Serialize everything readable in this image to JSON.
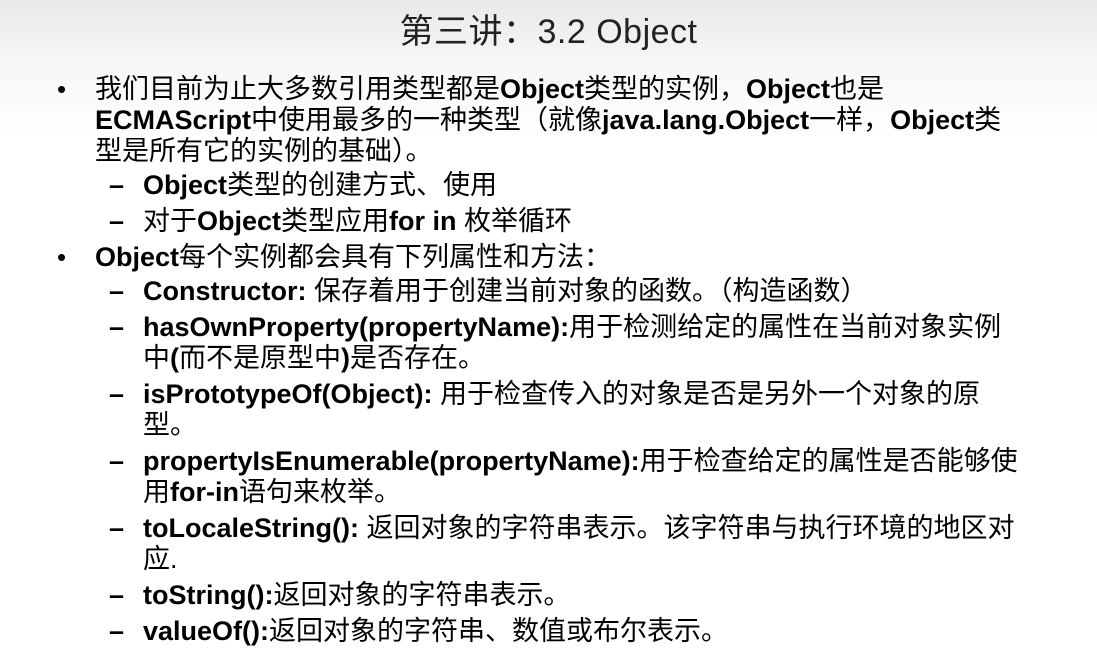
{
  "slide": {
    "title": "第三讲：3.2  Object",
    "bullet_char": "•",
    "dash_char": "–"
  },
  "items": [
    {
      "level": 1,
      "parts": [
        {
          "b": false,
          "text": "我们目前为止大多数引用类型都是"
        },
        {
          "b": true,
          "text": "Object"
        },
        {
          "b": false,
          "text": "类型的实例，"
        },
        {
          "b": true,
          "text": "Object"
        },
        {
          "b": false,
          "text": "也是"
        },
        {
          "b": true,
          "text": "ECMAScript"
        },
        {
          "b": false,
          "text": "中使用最多的一种类型（就像"
        },
        {
          "b": true,
          "text": "java.lang.Object"
        },
        {
          "b": false,
          "text": "一样，"
        },
        {
          "b": true,
          "text": "Object"
        },
        {
          "b": false,
          "text": "类型是所有它的实例的基础）。"
        }
      ]
    },
    {
      "level": 2,
      "parts": [
        {
          "b": true,
          "text": "Object"
        },
        {
          "b": false,
          "text": "类型的创建方式、使用"
        }
      ]
    },
    {
      "level": 2,
      "parts": [
        {
          "b": false,
          "text": "对于"
        },
        {
          "b": true,
          "text": "Object"
        },
        {
          "b": false,
          "text": "类型应用"
        },
        {
          "b": true,
          "text": "for in"
        },
        {
          "b": false,
          "text": " 枚举循环"
        }
      ]
    },
    {
      "level": 1,
      "parts": [
        {
          "b": true,
          "text": "Object"
        },
        {
          "b": false,
          "text": "每个实例都会具有下列属性和方法："
        }
      ]
    },
    {
      "level": 2,
      "parts": [
        {
          "b": true,
          "text": "Constructor:"
        },
        {
          "b": false,
          "text": " 保存着用于创建当前对象的函数。（构造函数）"
        }
      ]
    },
    {
      "level": 2,
      "parts": [
        {
          "b": true,
          "text": "hasOwnProperty(propertyName):"
        },
        {
          "b": false,
          "text": "用于检测给定的属性在当前对象实例中"
        },
        {
          "b": true,
          "text": "("
        },
        {
          "b": false,
          "text": "而不是原型中"
        },
        {
          "b": true,
          "text": ")"
        },
        {
          "b": false,
          "text": "是否存在。"
        }
      ]
    },
    {
      "level": 2,
      "parts": [
        {
          "b": true,
          "text": "isPrototypeOf(Object):"
        },
        {
          "b": false,
          "text": " 用于检查传入的对象是否是另外一个对象的原型。"
        }
      ]
    },
    {
      "level": 2,
      "parts": [
        {
          "b": true,
          "text": "propertyIsEnumerable(propertyName):"
        },
        {
          "b": false,
          "text": "用于检查给定的属性是否能够使用"
        },
        {
          "b": true,
          "text": "for-in"
        },
        {
          "b": false,
          "text": "语句来枚举。"
        }
      ]
    },
    {
      "level": 2,
      "parts": [
        {
          "b": true,
          "text": "toLocaleString():"
        },
        {
          "b": false,
          "text": " 返回对象的字符串表示。该字符串与执行环境的地区对应."
        }
      ]
    },
    {
      "level": 2,
      "parts": [
        {
          "b": true,
          "text": "toString():"
        },
        {
          "b": false,
          "text": "返回对象的字符串表示。"
        }
      ]
    },
    {
      "level": 2,
      "parts": [
        {
          "b": true,
          "text": "valueOf():"
        },
        {
          "b": false,
          "text": "返回对象的字符串、数值或布尔表示。"
        }
      ]
    }
  ]
}
